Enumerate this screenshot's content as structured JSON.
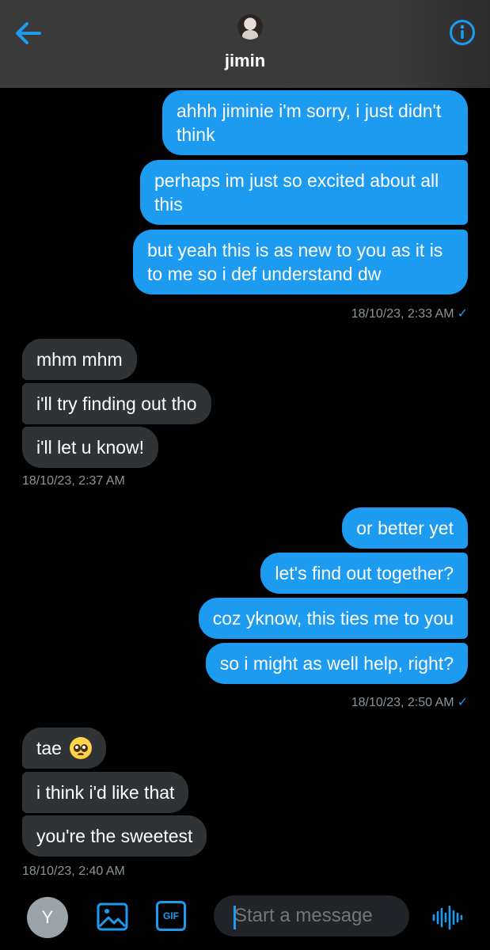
{
  "header": {
    "contact_name": "jimin",
    "back_icon": "back-arrow-icon",
    "info_icon": "info-icon"
  },
  "messages": [
    {
      "dir": "sent",
      "text": "ahhh jiminie i'm sorry, i just didn't think"
    },
    {
      "dir": "sent",
      "text": "perhaps im just so excited about all this"
    },
    {
      "dir": "sent",
      "text": "but yeah this is as new to you as it is to me so i def understand dw"
    },
    {
      "dir": "stamp",
      "text": "18/10/23, 2:33 AM",
      "read": true
    },
    {
      "dir": "recv",
      "text": "mhm mhm"
    },
    {
      "dir": "recv",
      "text": "i'll try finding out tho"
    },
    {
      "dir": "recv",
      "text": "i'll let u know!"
    },
    {
      "dir": "stamp",
      "text": "18/10/23, 2:37 AM"
    },
    {
      "dir": "sent",
      "text": "or better yet"
    },
    {
      "dir": "sent",
      "text": "let's find out together?"
    },
    {
      "dir": "sent",
      "text": "coz yknow, this ties me to you"
    },
    {
      "dir": "sent",
      "text": "so i might as well help, right?"
    },
    {
      "dir": "stamp",
      "text": "18/10/23, 2:50 AM",
      "read": true
    },
    {
      "dir": "recv",
      "text": "tae",
      "emoji": "pleading-face-emoji"
    },
    {
      "dir": "recv",
      "text": "i think i'd like that"
    },
    {
      "dir": "recv",
      "text": "you're the sweetest"
    },
    {
      "dir": "stamp",
      "text": "18/10/23, 2:40 AM"
    }
  ],
  "composer": {
    "avatar_initial": "Y",
    "gif_label": "GIF",
    "placeholder": "Start a message"
  },
  "colors": {
    "accent": "#1d9bf0",
    "received_bubble": "#2f3336",
    "header_bg": "#3a3a3a",
    "timestamp": "#8b949a"
  }
}
